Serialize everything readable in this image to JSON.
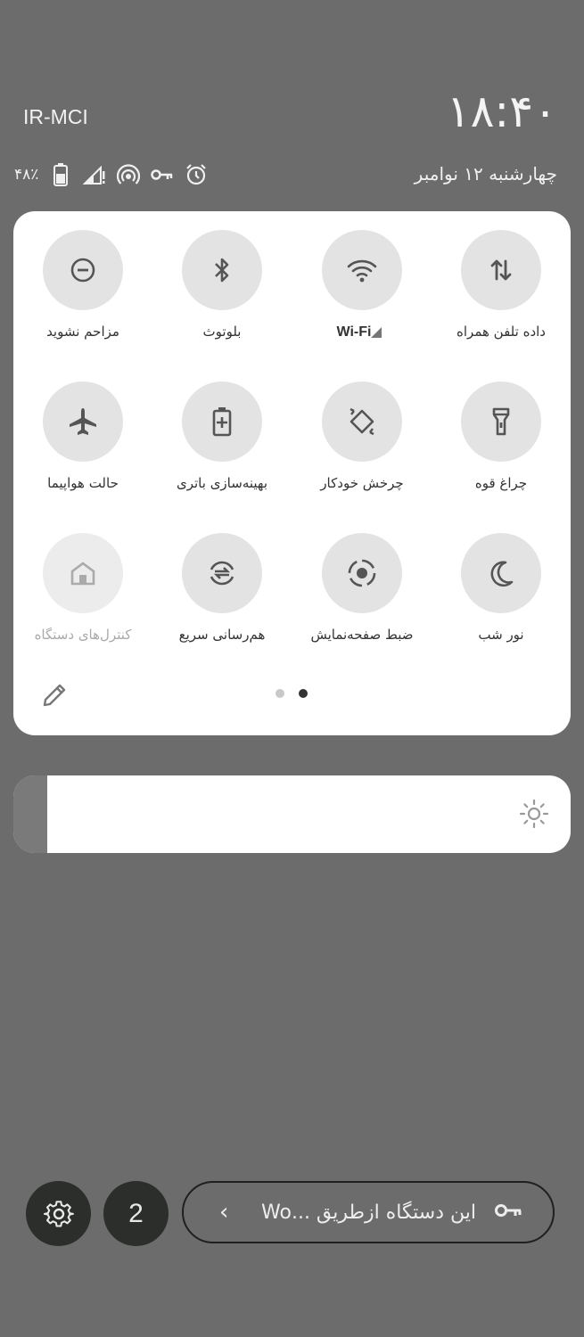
{
  "status_bar": {
    "carrier": "IR-MCI",
    "clock": "۱۸:۴۰",
    "date": "چهارشنبه ۱۲ نوامبر",
    "battery_percent": "۴۸٪"
  },
  "quick_settings": {
    "tiles": [
      {
        "id": "mobile-data",
        "label": "داده تلفن همراه",
        "icon": "mobile-data-icon",
        "enabled": true
      },
      {
        "id": "wifi",
        "label": "Wi-Fi",
        "icon": "wifi-icon",
        "enabled": true
      },
      {
        "id": "bluetooth",
        "label": "بلوتوث",
        "icon": "bluetooth-icon",
        "enabled": true
      },
      {
        "id": "dnd",
        "label": "مزاحم نشوید",
        "icon": "do-not-disturb-icon",
        "enabled": true
      },
      {
        "id": "flashlight",
        "label": "چراغ قوه",
        "icon": "flashlight-icon",
        "enabled": true
      },
      {
        "id": "autorotate",
        "label": "چرخش خودکار",
        "icon": "auto-rotate-icon",
        "enabled": true
      },
      {
        "id": "battery-saver",
        "label": "بهینه‌سازی باتری",
        "icon": "battery-saver-icon",
        "enabled": true
      },
      {
        "id": "airplane",
        "label": "حالت هواپیما",
        "icon": "airplane-icon",
        "enabled": true
      },
      {
        "id": "night-light",
        "label": "نور شب",
        "icon": "night-light-icon",
        "enabled": true
      },
      {
        "id": "screen-record",
        "label": "ضبط صفحه‌نمایش",
        "icon": "screen-record-icon",
        "enabled": true
      },
      {
        "id": "quick-share",
        "label": "هم‌رسانی سریع",
        "icon": "quick-share-icon",
        "enabled": true
      },
      {
        "id": "device-controls",
        "label": "کنترل‌های دستگاه",
        "icon": "home-icon",
        "enabled": false
      }
    ],
    "page_count": 2,
    "active_page": 2
  },
  "brightness": {
    "level": 0.06
  },
  "bottom_bar": {
    "notification_count": "2",
    "vpn_text": "این دستگاه ازطریق ...Wo"
  },
  "colors": {
    "background": "#6c6c6c",
    "panel": "#ffffff",
    "tile_circle": "#e3e3e3",
    "dark_button": "#2b2e2b"
  }
}
